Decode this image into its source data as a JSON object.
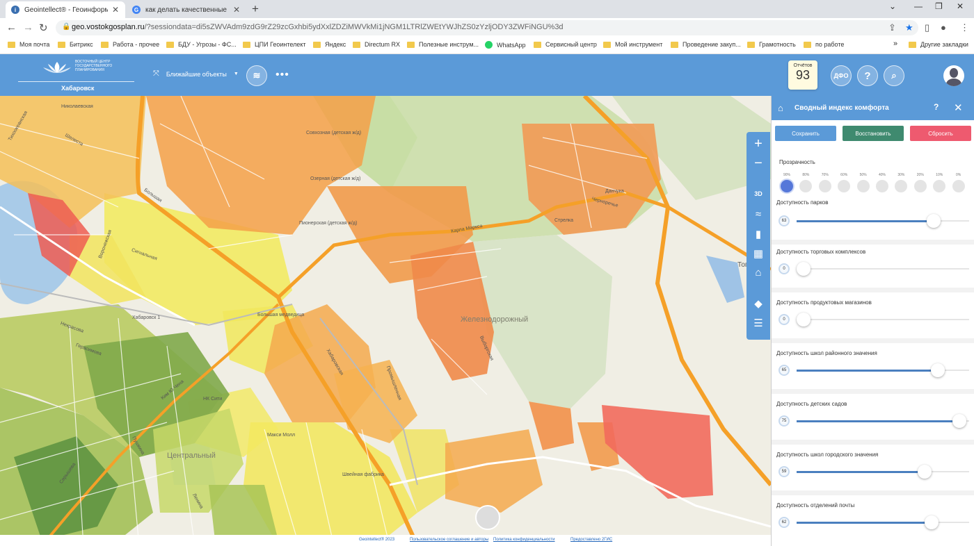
{
  "browser": {
    "tabs": [
      {
        "title": "Geointellect® - Геоинформаци",
        "active": true
      },
      {
        "title": "как делать качественные сним",
        "active": false
      }
    ],
    "url_prefix": "geo.vostokgosplan.ru",
    "url_rest": "/?sessiondata=di5sZWVAdm9zdG9rZ29zcGxhbi5ydXxlZDZiMWVkMi1jNGM1LTRlZWEtYWJhZS0zYzljODY3ZWFiNGU%3d",
    "bookmarks": [
      "Моя почта",
      "Битрикс",
      "Работа - прочее",
      "БДУ - Угрозы - ФС...",
      "ЦПИ Геоинтелект",
      "Яндекс",
      "Directum RX",
      "Полезные инструм...",
      "WhatsApp",
      "Сервисный центр",
      "Мой инструмент",
      "Проведение закуп...",
      "Грамотность",
      "по работе"
    ],
    "other_bookmarks": "Другие закладки"
  },
  "header": {
    "logo_text": "ВОСТОЧНЫЙ ЦЕНТР ГОСУДАРСТВЕННОГО ПЛАНИРОВАНИЯ",
    "city": "Хабаровск",
    "nearby_label": "Ближайшие объекты",
    "reports_label": "Отчётов",
    "reports_count": "93",
    "dfo_label": "ДФО",
    "help_label": "?",
    "primary_color": "#5b9ad8"
  },
  "map": {
    "labels": [
      "Николаевская",
      "Шелеста",
      "Тихоокеанская",
      "Совхозная (детская ж/д)",
      "Озерная (детская ж/д)",
      "Пионерская (детская ж/д)",
      "Сигнальная",
      "Воронежская",
      "Большая",
      "Карла Маркса",
      "Хабаровск 1",
      "Большая медведица",
      "Некрасова",
      "Герасимова",
      "Хабаровская",
      "Промышленная",
      "Выборгская",
      "Ким Ю Чена",
      "НК Сити",
      "Макси Молл",
      "Швейная фабрика",
      "Стрелка",
      "Данчука",
      "Черноречье",
      "Тополево",
      "Серышева",
      "Пушкина",
      "Ленина"
    ],
    "districts": [
      "Железнодорожный",
      "Центральный"
    ],
    "zoom_in": "+",
    "zoom_out": "−",
    "mode_3d": "3D"
  },
  "footer": {
    "copyright": "Geointellect® 2023",
    "terms": "Пользовательское соглашение и авторы",
    "privacy": "Политика конфиденциальности",
    "provider": "Предоставлено 2ГИС"
  },
  "panel": {
    "title": "Сводный индекс комфорта",
    "save": "Сохранить",
    "restore": "Восстановить",
    "reset": "Сбросить",
    "transparency_label": "Прозрачность",
    "transparency_options": [
      "90%",
      "80%",
      "70%",
      "60%",
      "50%",
      "40%",
      "30%",
      "20%",
      "10%",
      "0%"
    ],
    "transparency_selected": "90%",
    "sliders": [
      {
        "label": "Доступность парков",
        "value": 63
      },
      {
        "label": "Доступность торговых комплексов",
        "value": 0
      },
      {
        "label": "Доступность продуктовых магазинов",
        "value": 0
      },
      {
        "label": "Доступность школ районного значения",
        "value": 65
      },
      {
        "label": "Доступность детских садов",
        "value": 75
      },
      {
        "label": "Доступность школ городского значения",
        "value": 59
      },
      {
        "label": "Доступность отделений почты",
        "value": 62
      }
    ],
    "button_colors": {
      "save": "#5b9ad8",
      "restore": "#3f8a6f",
      "reset": "#ee5a6f"
    }
  }
}
